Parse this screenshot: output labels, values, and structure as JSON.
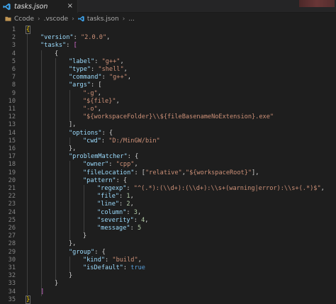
{
  "tab": {
    "label": "tasks.json",
    "close": "×"
  },
  "breadcrumb": {
    "root": "Ccode",
    "folder": ".vscode",
    "file": "tasks.json",
    "trail": "..."
  },
  "colors": {
    "key": "#9cdcfe",
    "string": "#ce9178",
    "number": "#b5cea8",
    "keyword": "#569cd6",
    "line_number": "#858585"
  },
  "lines": [
    [
      [
        "y",
        "{"
      ]
    ],
    [
      [
        "k",
        "\"version\""
      ],
      [
        "p",
        ": "
      ],
      [
        "s",
        "\"2.0.0\""
      ],
      [
        "p",
        ","
      ]
    ],
    [
      [
        "k",
        "\"tasks\""
      ],
      [
        "p",
        ": "
      ],
      [
        "m",
        "["
      ]
    ],
    [
      [
        "p",
        "{"
      ]
    ],
    [
      [
        "k",
        "\"label\""
      ],
      [
        "p",
        ": "
      ],
      [
        "s",
        "\"g++\""
      ],
      [
        "p",
        ","
      ]
    ],
    [
      [
        "k",
        "\"type\""
      ],
      [
        "p",
        ": "
      ],
      [
        "s",
        "\"shell\""
      ],
      [
        "p",
        ","
      ]
    ],
    [
      [
        "k",
        "\"command\""
      ],
      [
        "p",
        ": "
      ],
      [
        "s",
        "\"g++\""
      ],
      [
        "p",
        ","
      ]
    ],
    [
      [
        "k",
        "\"args\""
      ],
      [
        "p",
        ": ["
      ]
    ],
    [
      [
        "s",
        "\"-g\""
      ],
      [
        "p",
        ","
      ]
    ],
    [
      [
        "s",
        "\"${file}\""
      ],
      [
        "p",
        ","
      ]
    ],
    [
      [
        "s",
        "\"-o\""
      ],
      [
        "p",
        ","
      ]
    ],
    [
      [
        "s",
        "\"${workspaceFolder}\\\\${fileBasenameNoExtension}.exe\""
      ]
    ],
    [
      [
        "p",
        "],"
      ]
    ],
    [
      [
        "k",
        "\"options\""
      ],
      [
        "p",
        ": {"
      ]
    ],
    [
      [
        "k",
        "\"cwd\""
      ],
      [
        "p",
        ": "
      ],
      [
        "s",
        "\"D:/MinGW/bin\""
      ]
    ],
    [
      [
        "p",
        "},"
      ]
    ],
    [
      [
        "k",
        "\"problemMatcher\""
      ],
      [
        "p",
        ": {"
      ]
    ],
    [
      [
        "k",
        "\"owner\""
      ],
      [
        "p",
        ": "
      ],
      [
        "s",
        "\"cpp\""
      ],
      [
        "p",
        ","
      ]
    ],
    [
      [
        "k",
        "\"fileLocation\""
      ],
      [
        "p",
        ": ["
      ],
      [
        "s",
        "\"relative\""
      ],
      [
        "p",
        ","
      ],
      [
        "s",
        "\"${workspaceRoot}\""
      ],
      [
        "p",
        "],"
      ]
    ],
    [
      [
        "k",
        "\"pattern\""
      ],
      [
        "p",
        ": {"
      ]
    ],
    [
      [
        "k",
        "\"regexp\""
      ],
      [
        "p",
        ": "
      ],
      [
        "s",
        "\"^(.*):(\\\\d+):(\\\\d+):\\\\s+(warning|error):\\\\s+(.*)$\""
      ],
      [
        "p",
        ","
      ]
    ],
    [
      [
        "k",
        "\"file\""
      ],
      [
        "p",
        ": "
      ],
      [
        "n",
        "1"
      ],
      [
        "p",
        ","
      ]
    ],
    [
      [
        "k",
        "\"line\""
      ],
      [
        "p",
        ": "
      ],
      [
        "n",
        "2"
      ],
      [
        "p",
        ","
      ]
    ],
    [
      [
        "k",
        "\"column\""
      ],
      [
        "p",
        ": "
      ],
      [
        "n",
        "3"
      ],
      [
        "p",
        ","
      ]
    ],
    [
      [
        "k",
        "\"severity\""
      ],
      [
        "p",
        ": "
      ],
      [
        "n",
        "4"
      ],
      [
        "p",
        ","
      ]
    ],
    [
      [
        "k",
        "\"message\""
      ],
      [
        "p",
        ": "
      ],
      [
        "n",
        "5"
      ]
    ],
    [
      [
        "p",
        "}"
      ]
    ],
    [
      [
        "p",
        "},"
      ]
    ],
    [
      [
        "k",
        "\"group\""
      ],
      [
        "p",
        ": {"
      ]
    ],
    [
      [
        "k",
        "\"kind\""
      ],
      [
        "p",
        ": "
      ],
      [
        "s",
        "\"build\""
      ],
      [
        "p",
        ","
      ]
    ],
    [
      [
        "k",
        "\"isDefault\""
      ],
      [
        "p",
        ": "
      ],
      [
        "b",
        "true"
      ]
    ],
    [
      [
        "p",
        "}"
      ]
    ],
    [
      [
        "p",
        "}"
      ]
    ],
    [
      [
        "m",
        "]"
      ]
    ],
    [
      [
        "y",
        "}"
      ]
    ]
  ]
}
